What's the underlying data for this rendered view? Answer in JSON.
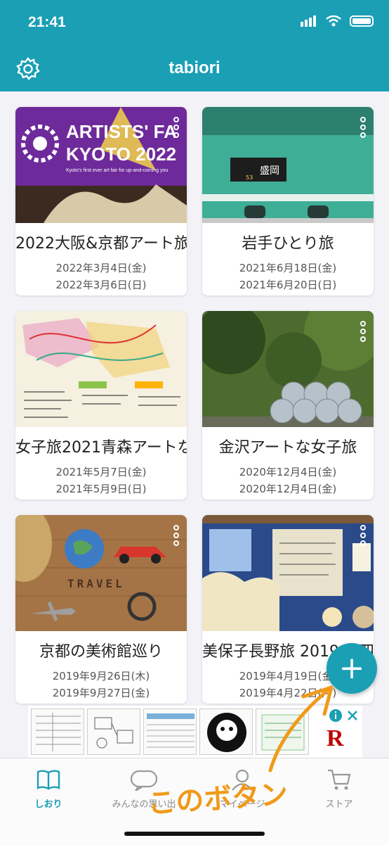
{
  "status": {
    "time": "21:41"
  },
  "header": {
    "title": "tabiori"
  },
  "cards": [
    {
      "title": "2022大阪&京都アート旅",
      "date_start": "2022年3月4日(金)",
      "date_end": "2022年3月6日(日)",
      "image_text": [
        "ARTISTS' FA",
        "KYOTO 2022",
        "Kyoto's first ever art fair for up-and-coming you"
      ]
    },
    {
      "title": "岩手ひとり旅",
      "date_start": "2021年6月18日(金)",
      "date_end": "2021年6月20日(日)",
      "image_text": [
        "盛岡",
        "53"
      ]
    },
    {
      "title": "女子旅2021青森アートな",
      "date_start": "2021年5月7日(金)",
      "date_end": "2021年5月9日(日)"
    },
    {
      "title": "金沢アートな女子旅",
      "date_start": "2020年12月4日(金)",
      "date_end": "2020年12月4日(金)"
    },
    {
      "title": "京都の美術館巡り",
      "date_start": "2019年9月26日(木)",
      "date_end": "2019年9月27日(金)",
      "image_text": [
        "TRAVEL"
      ]
    },
    {
      "title": "美保子長野旅 2019.4 四&",
      "date_start": "2019年4月19日(金)",
      "date_end": "2019年4月22日(月)"
    }
  ],
  "fab": {
    "label": "+"
  },
  "tabs": [
    {
      "label": "しおり",
      "icon": "book-icon",
      "active": true
    },
    {
      "label": "みんなの思い出",
      "icon": "bubble-icon",
      "active": false
    },
    {
      "label": "マイページ",
      "icon": "person-icon",
      "active": false
    },
    {
      "label": "ストア",
      "icon": "cart-icon",
      "active": false
    }
  ],
  "annotation": {
    "text": "このボタン",
    "color": "#f09a1a"
  },
  "ad": {
    "logo": "R"
  },
  "colors": {
    "accent": "#1a9fb5"
  }
}
